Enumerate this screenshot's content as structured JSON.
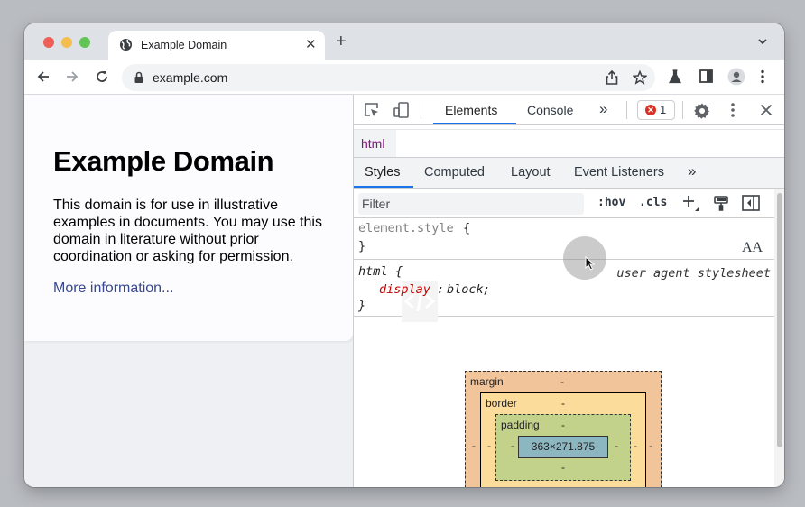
{
  "browser": {
    "tab_title": "Example Domain",
    "url": "example.com",
    "colors": {
      "close": "#ee5f57",
      "minimize": "#f5bd4f",
      "maximize": "#61c454"
    }
  },
  "page": {
    "heading": "Example Domain",
    "paragraph": "This domain is for use in illustrative examples in documents. You may use this domain in literature without prior coordination or asking for permission.",
    "link": "More information..."
  },
  "devtools": {
    "tabs": [
      "Elements",
      "Console"
    ],
    "more": "»",
    "error_count": "1",
    "breadcrumb": "html",
    "subtabs": [
      "Styles",
      "Computed",
      "Layout",
      "Event Listeners"
    ],
    "filter_placeholder": "Filter",
    "hov": ":hov",
    "cls": ".cls",
    "rules": {
      "element_style": "element.style",
      "html_selector": "html",
      "ua_label": "user agent stylesheet",
      "property": "display",
      "value": "block"
    },
    "text_size_icon": "AA",
    "box_model": {
      "margin": "margin",
      "border": "border",
      "padding": "padding",
      "content": "363×271.875",
      "dash": "-"
    }
  }
}
